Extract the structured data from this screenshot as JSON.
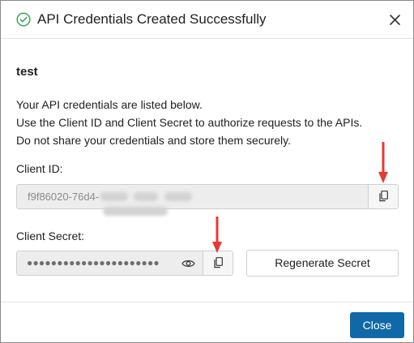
{
  "dialog": {
    "title": "API Credentials Created Successfully",
    "close_icon": "close-icon",
    "success_icon": "check-circle-icon"
  },
  "app": {
    "name": "test"
  },
  "description": {
    "line1": "Your API credentials are listed below.",
    "line2": "Use the Client ID and Client Secret to authorize requests to the APIs.",
    "line3": "Do not share your credentials and store them securely."
  },
  "client_id": {
    "label": "Client ID:",
    "visible_value": "f9f86020-76d4-",
    "copy_icon": "copy-icon"
  },
  "client_secret": {
    "label": "Client Secret:",
    "masked_value": "●●●●●●●●●●●●●●●●●●●●●●",
    "reveal_icon": "eye-icon",
    "copy_icon": "copy-icon"
  },
  "actions": {
    "regenerate_label": "Regenerate Secret",
    "close_label": "Close"
  },
  "colors": {
    "primary": "#1168a6",
    "success": "#3aa757",
    "annotation_arrow": "#e53935"
  }
}
